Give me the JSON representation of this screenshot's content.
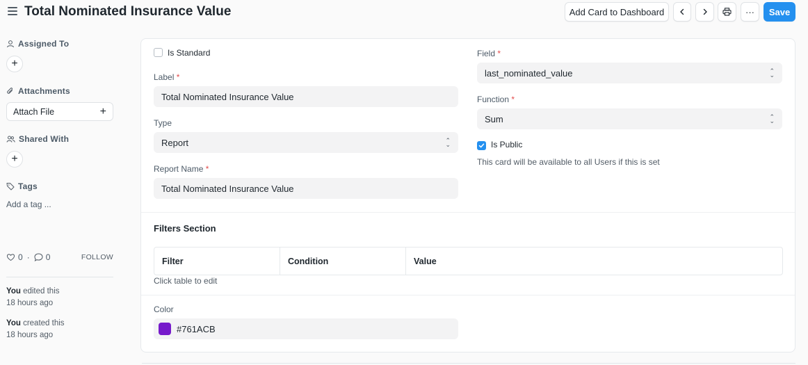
{
  "header": {
    "title": "Total Nominated Insurance Value",
    "add_card_label": "Add Card to Dashboard",
    "save_label": "Save",
    "more_label": "···"
  },
  "sidebar": {
    "assigned_to": "Assigned To",
    "attachments": "Attachments",
    "attach_file": "Attach File",
    "shared_with": "Shared With",
    "tags": "Tags",
    "add_tag": "Add a tag ...",
    "likes_count": "0",
    "comments_count": "0",
    "separator": "·",
    "follow": "FOLLOW",
    "activity": [
      {
        "who": "You",
        "action": "edited this",
        "when": "18 hours ago"
      },
      {
        "who": "You",
        "action": "created this",
        "when": "18 hours ago"
      }
    ]
  },
  "form": {
    "is_standard": {
      "label": "Is Standard",
      "checked": false
    },
    "label": {
      "label": "Label",
      "value": "Total Nominated Insurance Value"
    },
    "type": {
      "label": "Type",
      "value": "Report"
    },
    "report_name": {
      "label": "Report Name",
      "value": "Total Nominated Insurance Value"
    },
    "field": {
      "label": "Field",
      "value": "last_nominated_value"
    },
    "function": {
      "label": "Function",
      "value": "Sum"
    },
    "is_public": {
      "label": "Is Public",
      "checked": true,
      "help": "This card will be available to all Users if this is set"
    },
    "required_mark": "*",
    "filters_section": {
      "title": "Filters Section",
      "columns": [
        "Filter",
        "Condition",
        "Value"
      ],
      "hint": "Click table to edit"
    },
    "color": {
      "label": "Color",
      "value": "#761ACB"
    }
  },
  "colors": {
    "accent": "#2490ef",
    "swatch": "#761ACB"
  }
}
